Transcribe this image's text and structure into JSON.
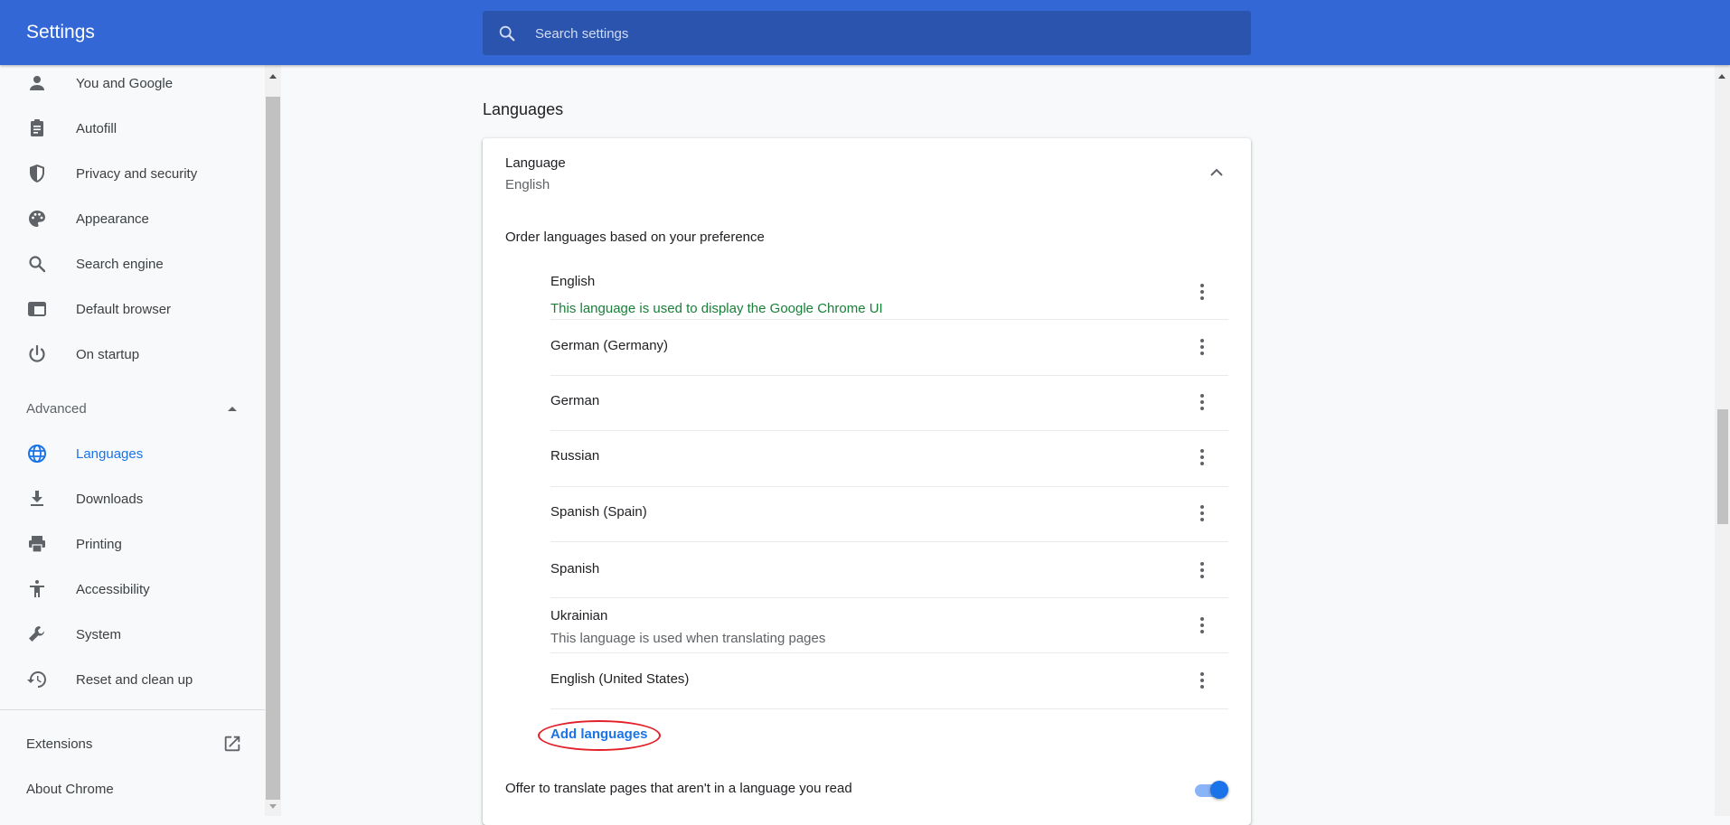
{
  "header": {
    "title": "Settings",
    "search_placeholder": "Search settings"
  },
  "sidebar": {
    "items": [
      {
        "label": "You and Google",
        "icon": "person-icon"
      },
      {
        "label": "Autofill",
        "icon": "clipboard-icon"
      },
      {
        "label": "Privacy and security",
        "icon": "shield-icon"
      },
      {
        "label": "Appearance",
        "icon": "palette-icon"
      },
      {
        "label": "Search engine",
        "icon": "search-icon"
      },
      {
        "label": "Default browser",
        "icon": "browser-window-icon"
      },
      {
        "label": "On startup",
        "icon": "power-icon"
      }
    ],
    "advanced_label": "Advanced",
    "advanced_items": [
      {
        "label": "Languages",
        "icon": "globe-icon",
        "active": true
      },
      {
        "label": "Downloads",
        "icon": "download-icon"
      },
      {
        "label": "Printing",
        "icon": "printer-icon"
      },
      {
        "label": "Accessibility",
        "icon": "accessibility-icon"
      },
      {
        "label": "System",
        "icon": "wrench-icon"
      },
      {
        "label": "Reset and clean up",
        "icon": "history-icon"
      }
    ],
    "extensions_label": "Extensions",
    "about_label": "About Chrome"
  },
  "main": {
    "section_title": "Languages",
    "language_label": "Language",
    "language_value": "English",
    "order_label": "Order languages based on your preference",
    "languages": [
      {
        "name": "English",
        "note": "This language is used to display the Google Chrome UI",
        "note_color": "#188038"
      },
      {
        "name": "German (Germany)",
        "note": ""
      },
      {
        "name": "German",
        "note": ""
      },
      {
        "name": "Russian",
        "note": ""
      },
      {
        "name": "Spanish (Spain)",
        "note": ""
      },
      {
        "name": "Spanish",
        "note": ""
      },
      {
        "name": "Ukrainian",
        "note": "This language is used when translating pages",
        "note_color": "#5f6368"
      },
      {
        "name": "English (United States)",
        "note": ""
      }
    ],
    "add_languages_label": "Add languages",
    "offer_translate_label": "Offer to translate pages that aren't in a language you read",
    "offer_translate_enabled": true
  },
  "colors": {
    "header_bg": "#3367d6",
    "accent": "#1a73e8",
    "highlight_ellipse": "#e3202a"
  }
}
